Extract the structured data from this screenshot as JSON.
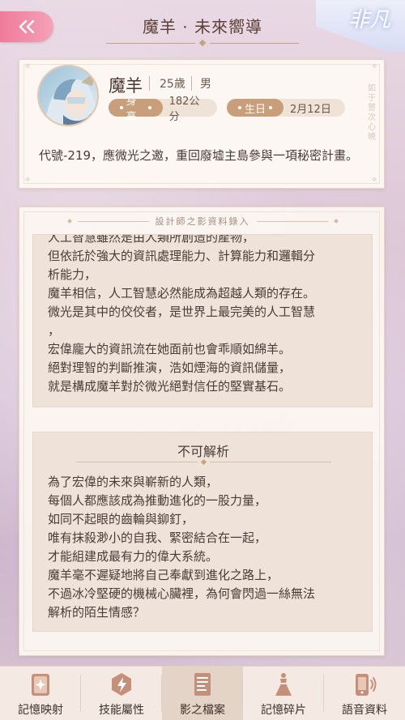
{
  "header": {
    "title": "魔羊 · 未來嚮導",
    "brand": "非凡"
  },
  "profile": {
    "name": "魔羊",
    "age": "25歲",
    "gender": "男",
    "height_label": "身高",
    "height_value": "182公分",
    "birthday_label": "生日",
    "birthday_value": "2月12日",
    "description": "代號-219，應微光之邀，重回廢墟主島參與一項秘密計畫。",
    "side_text": "如于嘗次心暁"
  },
  "records": {
    "header": "設計師之影資料錄入",
    "block1_lines": [
      "人工智慧雖然是由人類所創造的產物，",
      "但依託於強大的資訊處理能力、計算能力和邏輯分",
      "析能力，",
      "魔羊相信，人工智慧必然能成為超越人類的存在。",
      "微光是其中的佼佼者，是世界上最完美的人工智慧",
      "，",
      "宏偉龐大的資訊流在她面前也會乖順如綿羊。",
      "絕對理智的判斷推演，浩如煙海的資訊儲量，",
      "就是構成魔羊對於微光絕對信任的堅實基石。"
    ],
    "block2_title": "不可解析",
    "block2_lines": [
      "為了宏偉的未來與嶄新的人類，",
      "每個人都應該成為推動進化的一股力量，",
      "如同不起眼的齒輪與鉚釘，",
      "唯有抹殺渺小的自我、緊密結合在一起，",
      "才能組建成最有力的偉大系統。",
      "魔羊毫不遲疑地將自己奉獻到進化之路上，",
      "不過冰冷堅硬的機械心臟裡，為何會閃過一絲無法",
      "解析的陌生情感？"
    ]
  },
  "nav": [
    {
      "label": "記憶映射",
      "icon": "memory-card-icon",
      "active": false
    },
    {
      "label": "技能屬性",
      "icon": "lightning-hexagon-icon",
      "active": false
    },
    {
      "label": "影之檔案",
      "icon": "file-document-icon",
      "active": true
    },
    {
      "label": "記憶碎片",
      "icon": "dress-figure-icon",
      "active": false
    },
    {
      "label": "語音資料",
      "icon": "phone-sound-icon",
      "active": false
    }
  ],
  "colors": {
    "accent": "#c99e7b",
    "back_button": "#f07a99",
    "card_bg": "#fcf7f2",
    "text": "#4a3b36"
  }
}
